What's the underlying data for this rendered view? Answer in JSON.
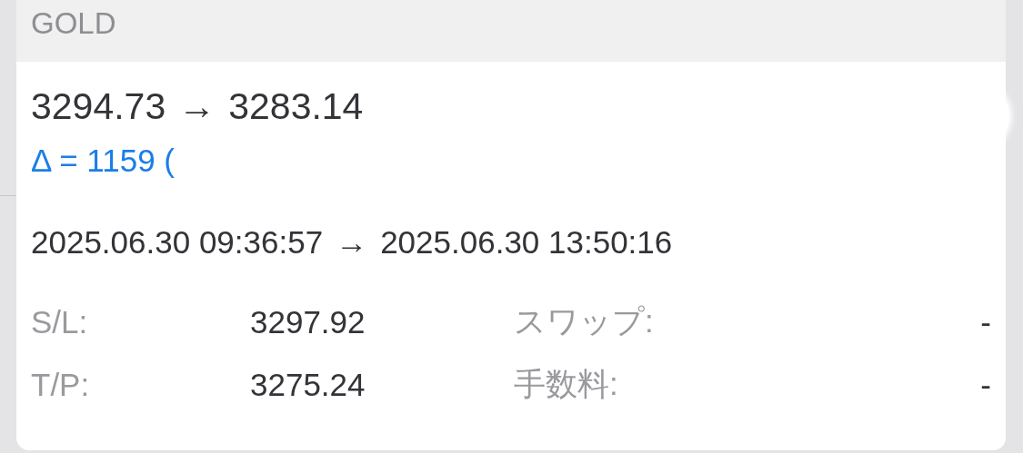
{
  "header": {
    "symbol": "GOLD"
  },
  "trade": {
    "open_price": "3294.73",
    "arrow": "→",
    "close_price": "3283.14",
    "delta": "Δ = 1159 (",
    "open_time": "2025.06.30 09:36:57",
    "time_arrow": "→",
    "close_time": "2025.06.30 13:50:16"
  },
  "details": [
    {
      "label": "S/L:",
      "value": "3297.92",
      "label_2": "スワップ:",
      "value_2": "-"
    },
    {
      "label": "T/P:",
      "value": "3275.24",
      "label_2": "手数料:",
      "value_2": "-"
    }
  ]
}
